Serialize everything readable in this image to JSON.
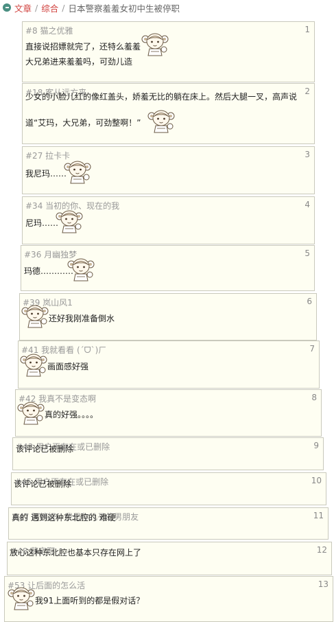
{
  "breadcrumb": {
    "icon": "home-icon",
    "link1": "文章",
    "link2": "综合",
    "sep": "/",
    "current": "日本警察羞羞女初中生被停职"
  },
  "colors": {
    "floor_bg": "#fefef2",
    "floor_border": "#c9c9bc",
    "link": "#d0403d",
    "meta": "#999999",
    "icon_bg": "#4a8f82"
  },
  "floors": [
    {
      "num": "1",
      "user": "#8 猫之优雅",
      "lines": [
        "直接说招嫖就完了，还特么羞羞",
        "大兄弟进来羞羞吗，可劲儿造"
      ],
      "emoticon": "anime-girl-emoticon"
    },
    {
      "num": "2",
      "user": "#18 客从远方来",
      "lines": [
        "少女的小脸儿红的像红盖头，娇羞无比的躺在床上。然后大腿一叉，高声说",
        "道“艾玛，大兄弟，可劲整啊！”"
      ],
      "emoticon": "anime-girl-emoticon"
    },
    {
      "num": "3",
      "user": "#27 拉卡卡",
      "lines": [
        "我尼玛……"
      ],
      "emoticon": "anime-girl-emoticon"
    },
    {
      "num": "4",
      "user": "#34 当初的你、现在的我",
      "lines": [
        "尼玛……"
      ],
      "emoticon": "anime-girl-emoticon"
    },
    {
      "num": "5",
      "user": "#36 月幽独梦",
      "lines": [
        "玛德…………"
      ],
      "emoticon": "anime-girl-emoticon"
    },
    {
      "num": "6",
      "user": "#39 岚山风1",
      "lines": [
        "还好我刚准备倒水"
      ],
      "emoticon": "anime-girl-emoticon"
    },
    {
      "num": "7",
      "user": "#41 我就看看 (ˊᗜˋ)ㄏ",
      "lines": [
        "画面感好强"
      ],
      "emoticon": "anime-girl-emoticon"
    },
    {
      "num": "8",
      "user": "#42 我真不是变态啊",
      "lines": [
        "真的好强。。。。"
      ],
      "emoticon": "anime-girl-emoticon"
    },
    {
      "num": "9",
      "user": "#43 用户不存在或已删除",
      "lines": [
        "该评论已被删除"
      ]
    },
    {
      "num": "10",
      "user": "#45 用户不存在或已删除",
      "lines": [
        "该评论已被删除"
      ]
    },
    {
      "num": "11",
      "user": "#47 阿姨好，我是你儿子的男朋友",
      "lines": [
        "真的  遇到这种东北腔的 难硬"
      ]
    },
    {
      "num": "12",
      "user": "#48 薛定鄂",
      "lines": [
        "放心这种东北腔也基本只存在网上了"
      ]
    },
    {
      "num": "13",
      "user": "#53 让后面的怎么活",
      "lines": [
        "我91上面听到的都是假对话？"
      ],
      "emoticon": "anime-girl-emoticon"
    }
  ]
}
